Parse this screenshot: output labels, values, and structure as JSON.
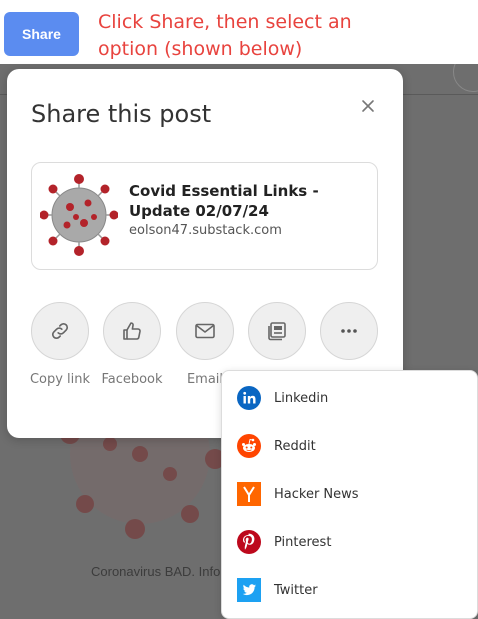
{
  "toolbar": {
    "share_label": "Share"
  },
  "instruction": "Click Share, then select an option (shown below)",
  "backdrop": {
    "caption": "Coronavirus BAD. Info"
  },
  "modal": {
    "title": "Share this post",
    "post": {
      "title": "Covid Essential Links - Update 02/07/24",
      "domain": "eolson47.substack.com"
    },
    "share_options": [
      {
        "label": "Copy link",
        "icon": "link-icon"
      },
      {
        "label": "Facebook",
        "icon": "thumbs-up-icon"
      },
      {
        "label": "Email",
        "icon": "envelope-icon"
      },
      {
        "label": "",
        "icon": "notes-icon"
      },
      {
        "label": "",
        "icon": "more-icon"
      }
    ]
  },
  "more_menu": {
    "items": [
      {
        "label": "Linkedin",
        "icon": "linkedin-icon",
        "color": "#0a66c2"
      },
      {
        "label": "Reddit",
        "icon": "reddit-icon",
        "color": "#ff4500"
      },
      {
        "label": "Hacker News",
        "icon": "hacker-news-icon",
        "color": "#ff6600"
      },
      {
        "label": "Pinterest",
        "icon": "pinterest-icon",
        "color": "#bd081c"
      },
      {
        "label": "Twitter",
        "icon": "twitter-icon",
        "color": "#1da1f2"
      }
    ]
  },
  "colors": {
    "accent": "#5b8cf0",
    "instruction_text": "#e8433e",
    "backdrop": "#6e6e6e"
  }
}
